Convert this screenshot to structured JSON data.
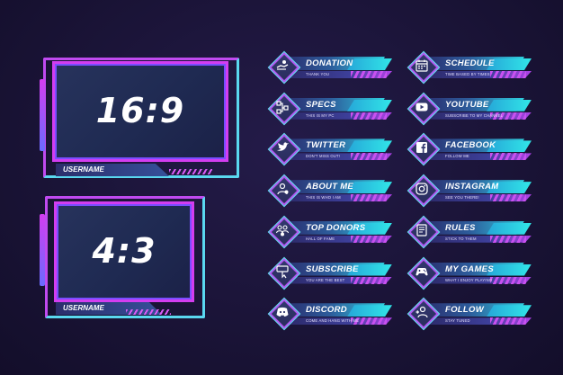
{
  "frames": [
    {
      "ratio": "16:9",
      "username": "USERNAME"
    },
    {
      "ratio": "4:3",
      "username": "USERNAME"
    }
  ],
  "panels_left": [
    {
      "title": "DONATION",
      "caption": "THANK YOU",
      "icon": "donation-hand-icon"
    },
    {
      "title": "SPECS",
      "caption": "THIS IS MY PC",
      "icon": "specs-tree-icon"
    },
    {
      "title": "TWITTER",
      "caption": "DON'T MISS OUT!",
      "icon": "twitter-bird-icon"
    },
    {
      "title": "ABOUT ME",
      "caption": "THIS IS WHO I AM",
      "icon": "about-me-user-icon"
    },
    {
      "title": "TOP DONORS",
      "caption": "HALL OF FAME",
      "icon": "donors-group-icon"
    },
    {
      "title": "SUBSCRIBE",
      "caption": "YOU ARE THE BEST",
      "icon": "subscribe-click-icon"
    },
    {
      "title": "DISCORD",
      "caption": "COME AND HANG WITH ME",
      "icon": "discord-icon"
    }
  ],
  "panels_right": [
    {
      "title": "SCHEDULE",
      "caption": "TIME BASED BY TIMES",
      "icon": "calendar-icon"
    },
    {
      "title": "YOUTUBE",
      "caption": "SUBSCRIBE TO MY CHANNEL",
      "icon": "youtube-play-icon"
    },
    {
      "title": "FACEBOOK",
      "caption": "FOLLOW ME",
      "icon": "facebook-icon"
    },
    {
      "title": "INSTAGRAM",
      "caption": "SEE YOU THERE!",
      "icon": "instagram-icon"
    },
    {
      "title": "RULES",
      "caption": "STICK TO THEM",
      "icon": "rules-scroll-icon"
    },
    {
      "title": "MY GAMES",
      "caption": "WHAT I ENJOY PLAYING",
      "icon": "gamepad-icon"
    },
    {
      "title": "FOLLOW",
      "caption": "STAY TUNED",
      "icon": "follow-user-icon"
    }
  ],
  "colors": {
    "accent_pink": "#d33df0",
    "accent_cyan": "#31e6e8",
    "background": "#1a1437"
  }
}
